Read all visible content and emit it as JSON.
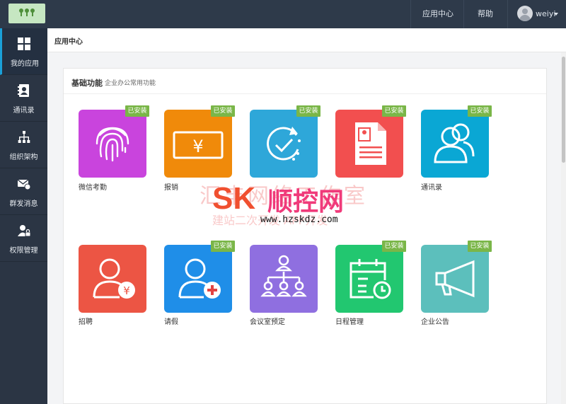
{
  "topbar": {
    "nav": [
      "应用中心",
      "帮助"
    ],
    "user": "weiyi"
  },
  "sidebar": {
    "items": [
      {
        "label": "我的应用",
        "icon": "grid-icon",
        "active": true
      },
      {
        "label": "通讯录",
        "icon": "contacts-icon",
        "active": false
      },
      {
        "label": "组织架构",
        "icon": "org-chart-icon",
        "active": false
      },
      {
        "label": "群发消息",
        "icon": "message-icon",
        "active": false
      },
      {
        "label": "权限管理",
        "icon": "user-lock-icon",
        "active": false
      }
    ]
  },
  "breadcrumb": "应用中心",
  "section": {
    "title": "基础功能",
    "subtitle": "企业办公常用功能"
  },
  "badge_text": "已安装",
  "apps": [
    {
      "label": "微信考勤",
      "icon": "fingerprint-icon",
      "color": "#c944dd",
      "installed": true
    },
    {
      "label": "报销",
      "icon": "yen-note-icon",
      "color": "#f08a0a",
      "installed": true
    },
    {
      "label": "",
      "icon": "refresh-check-icon",
      "color": "#2ea7d9",
      "installed": true
    },
    {
      "label": "",
      "icon": "contract-icon",
      "color": "#f24f4f",
      "installed": true
    },
    {
      "label": "通讯录",
      "icon": "users-icon",
      "color": "#0aa7d4",
      "installed": true
    },
    {
      "label": "招聘",
      "icon": "user-yen-icon",
      "color": "#ec5544",
      "installed": false
    },
    {
      "label": "请假",
      "icon": "user-plus-icon",
      "color": "#1f8ee8",
      "installed": true
    },
    {
      "label": "会议室预定",
      "icon": "meeting-org-icon",
      "color": "#8f6fe0",
      "installed": false
    },
    {
      "label": "日程管理",
      "icon": "calendar-clock-icon",
      "color": "#22c770",
      "installed": true
    },
    {
      "label": "企业公告",
      "icon": "megaphone-icon",
      "color": "#5cbfbc",
      "installed": true
    }
  ],
  "watermark": {
    "faded_big": "汇丰网络工作室",
    "brand_latin": "SK",
    "brand_cn": "顺控网",
    "faded_small": "建站二次开发 APP开发",
    "url": "www.hzskdz.com"
  }
}
